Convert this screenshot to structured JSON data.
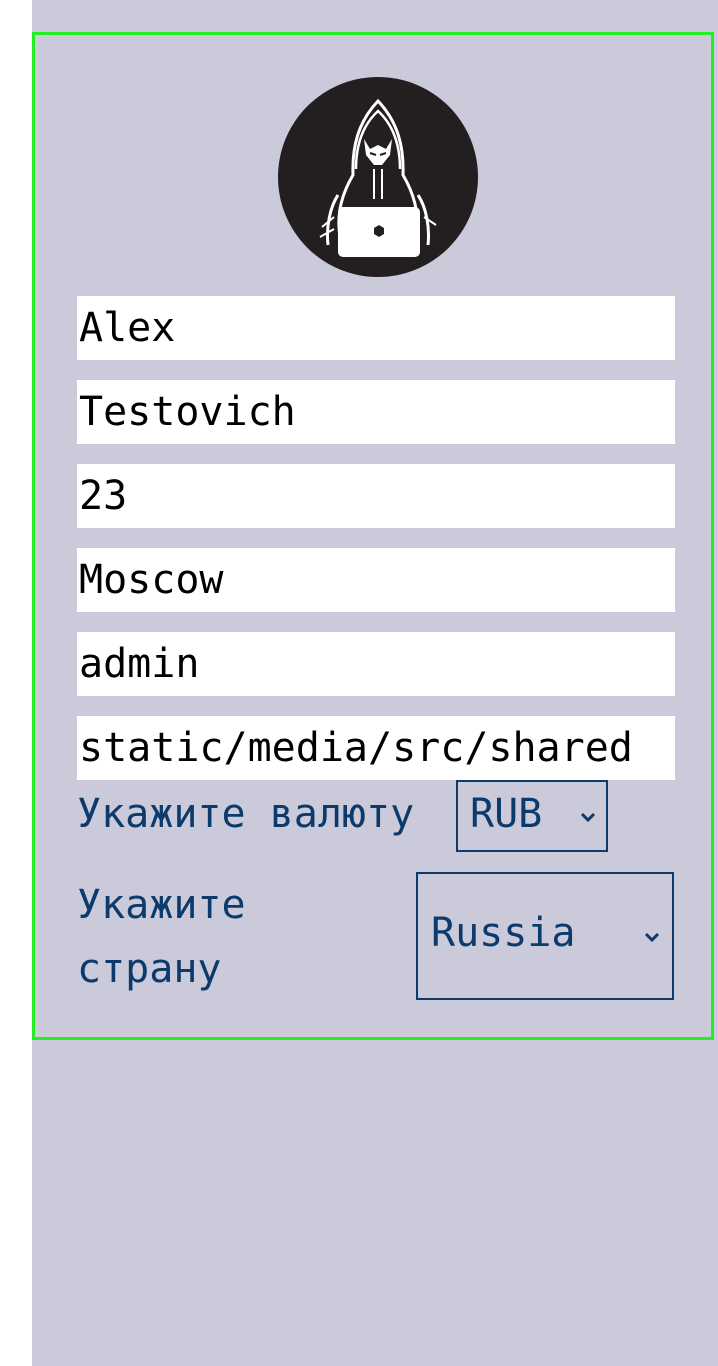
{
  "profile": {
    "first_name": "Alex",
    "last_name": "Testovich",
    "age": "23",
    "city": "Moscow",
    "role": "admin",
    "avatar_path": "static/media/src/shared"
  },
  "currency": {
    "label": "Укажите валюту",
    "selected": "RUB"
  },
  "country": {
    "label_line1": "Укажите",
    "label_line2": "страну",
    "selected": "Russia"
  },
  "colors": {
    "card_border": "#22ee22",
    "background": "#cbcadb",
    "label_text": "#0b3a6b",
    "avatar_bg": "#231f20"
  },
  "icons": {
    "avatar": "hacker-avatar-icon",
    "dropdown": "chevron-down-icon"
  }
}
